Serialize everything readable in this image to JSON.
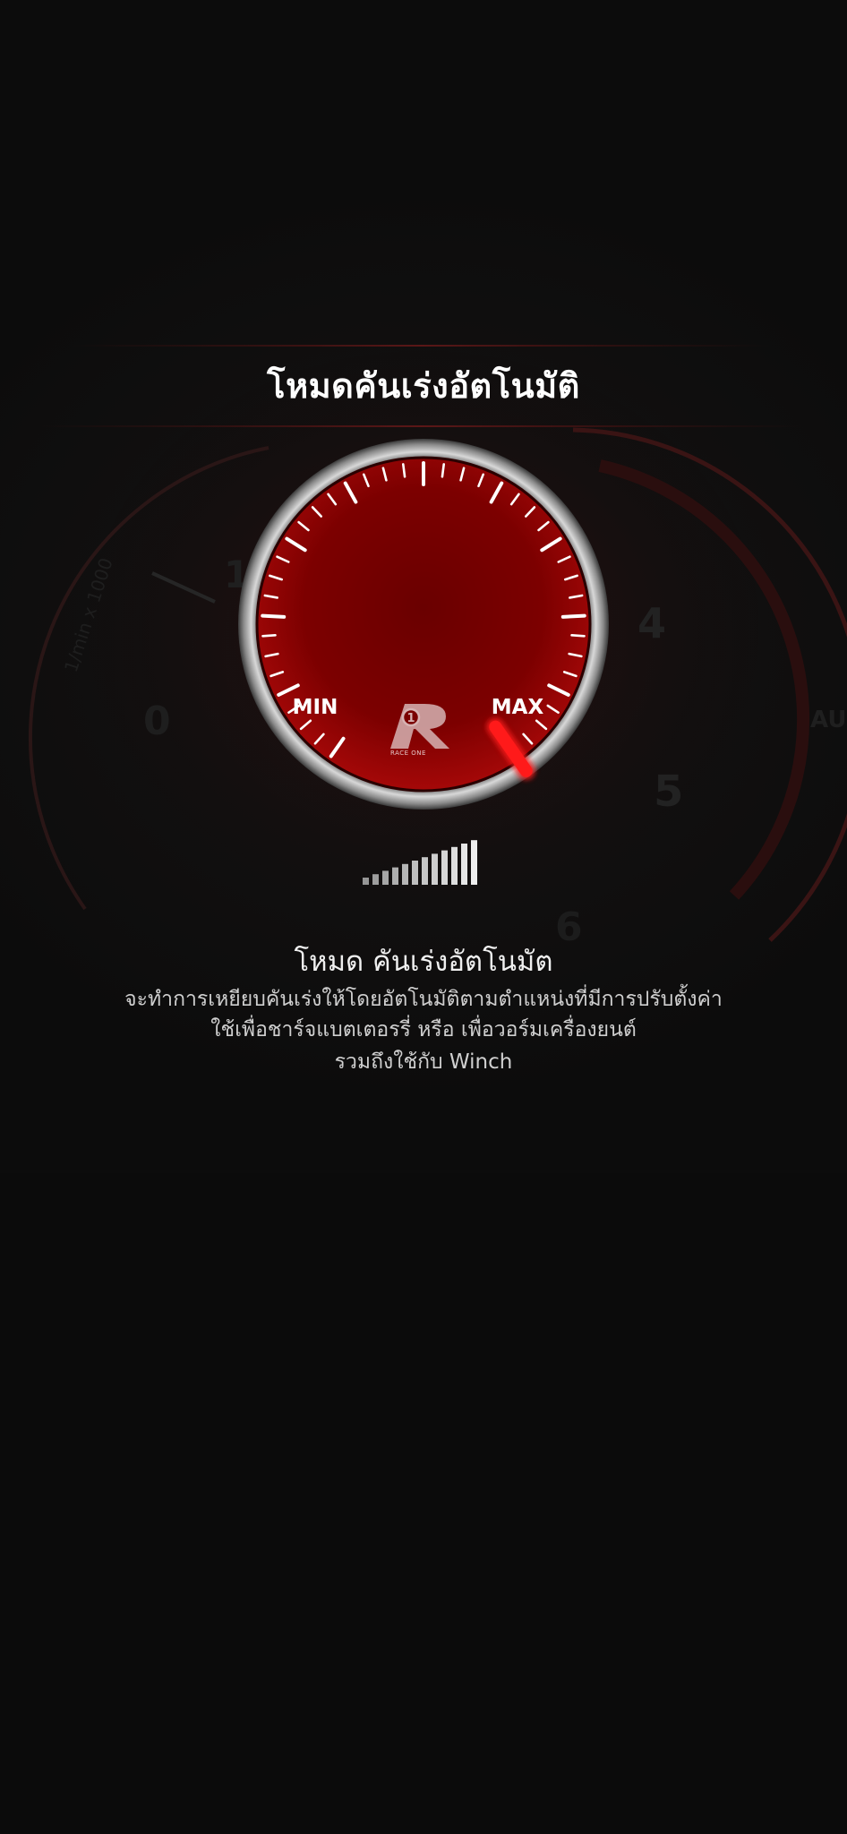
{
  "screen": {
    "title": "โหมดคันเร่งอัตโนมัติ"
  },
  "gauge": {
    "min_label": "MIN",
    "max_label": "MAX",
    "level": 1.0,
    "colors": {
      "dial_face": "#8a0000",
      "needle": "#ff1a1a",
      "bezel": "#c9c9c9"
    }
  },
  "logo": {
    "text": "RACE ONE"
  },
  "background": {
    "dial_numbers": [
      "1",
      "0",
      "4",
      "5",
      "6"
    ],
    "dial_unit": "1/min x 1000",
    "side_text": "AU"
  },
  "description": {
    "heading": "โหมด คันเร่งอัตโนมัต",
    "lines": [
      "จะทำการเหยียบคันเร่งให้โดยอัตโนมัติตามตำแหน่งที่มีการปรับตั้งค่า",
      "ใช้เพื่อชาร์จแบตเตอรรี่ หรือ เพื่อวอร์มเครื่องยนต์",
      "รวมถึงใช้กับ Winch"
    ]
  }
}
